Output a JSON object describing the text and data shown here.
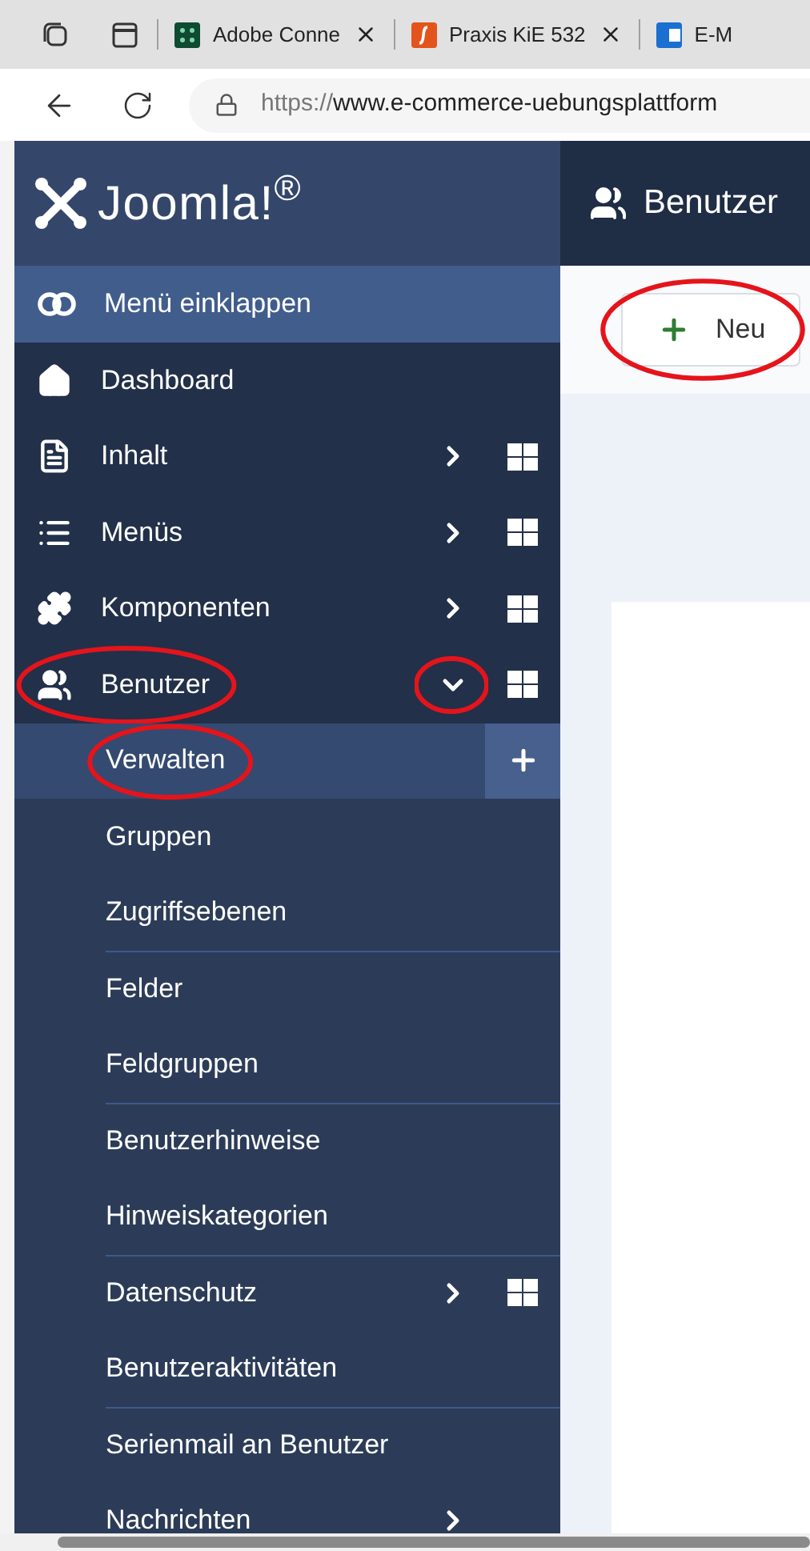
{
  "browser": {
    "tabs": [
      {
        "title": "Adobe Conne"
      },
      {
        "title": "Praxis KiE 532"
      },
      {
        "title": "E-M"
      }
    ],
    "url_prefix": "https://",
    "url": "www.e-commerce-uebungsplattform"
  },
  "brand": "Joomla!$^{®}$",
  "header": {
    "title": "Benutzer"
  },
  "toolbar": {
    "new_button": {
      "label": "Neu",
      "circled": true
    }
  },
  "sidebar": {
    "collapse": {
      "label": "Menü einklappen"
    },
    "items": [
      {
        "label": "Dashboard",
        "has_submenu": false,
        "expanded": false,
        "has_grid": false,
        "circled": false
      },
      {
        "label": "Inhalt",
        "has_submenu": true,
        "expanded": false,
        "has_grid": true,
        "circled": false
      },
      {
        "label": "Menüs",
        "has_submenu": true,
        "expanded": false,
        "has_grid": true,
        "circled": false
      },
      {
        "label": "Komponenten",
        "has_submenu": true,
        "expanded": false,
        "has_grid": true,
        "circled": false
      },
      {
        "label": "Benutzer",
        "has_submenu": true,
        "expanded": true,
        "has_grid": true,
        "circled": true,
        "children": [
          {
            "label": "Verwalten",
            "selected": true,
            "has_add": true,
            "divider_before": false,
            "has_submenu": false,
            "has_grid": false,
            "circled": true
          },
          {
            "label": "Gruppen",
            "selected": false,
            "has_add": false,
            "divider_before": false,
            "has_submenu": false,
            "has_grid": false,
            "circled": false
          },
          {
            "label": "Zugriffsebenen",
            "selected": false,
            "has_add": false,
            "divider_before": false,
            "has_submenu": false,
            "has_grid": false,
            "circled": false
          },
          {
            "label": "Felder",
            "selected": false,
            "has_add": false,
            "divider_before": true,
            "has_submenu": false,
            "has_grid": false,
            "circled": false
          },
          {
            "label": "Feldgruppen",
            "selected": false,
            "has_add": false,
            "divider_before": false,
            "has_submenu": false,
            "has_grid": false,
            "circled": false
          },
          {
            "label": "Benutzerhinweise",
            "selected": false,
            "has_add": false,
            "divider_before": true,
            "has_submenu": false,
            "has_grid": false,
            "circled": false
          },
          {
            "label": "Hinweiskategorien",
            "selected": false,
            "has_add": false,
            "divider_before": false,
            "has_submenu": false,
            "has_grid": false,
            "circled": false
          },
          {
            "label": "Datenschutz",
            "selected": false,
            "has_add": false,
            "divider_before": true,
            "has_submenu": true,
            "has_grid": true,
            "circled": false
          },
          {
            "label": "Benutzeraktivitäten",
            "selected": false,
            "has_add": false,
            "divider_before": false,
            "has_submenu": false,
            "has_grid": false,
            "circled": false
          },
          {
            "label": "Serienmail an Benutzer",
            "selected": false,
            "has_add": false,
            "divider_before": true,
            "has_submenu": false,
            "has_grid": false,
            "circled": false
          },
          {
            "label": "Nachrichten",
            "selected": false,
            "has_add": false,
            "divider_before": false,
            "has_submenu": true,
            "has_grid": false,
            "circled": false
          }
        ]
      }
    ]
  }
}
